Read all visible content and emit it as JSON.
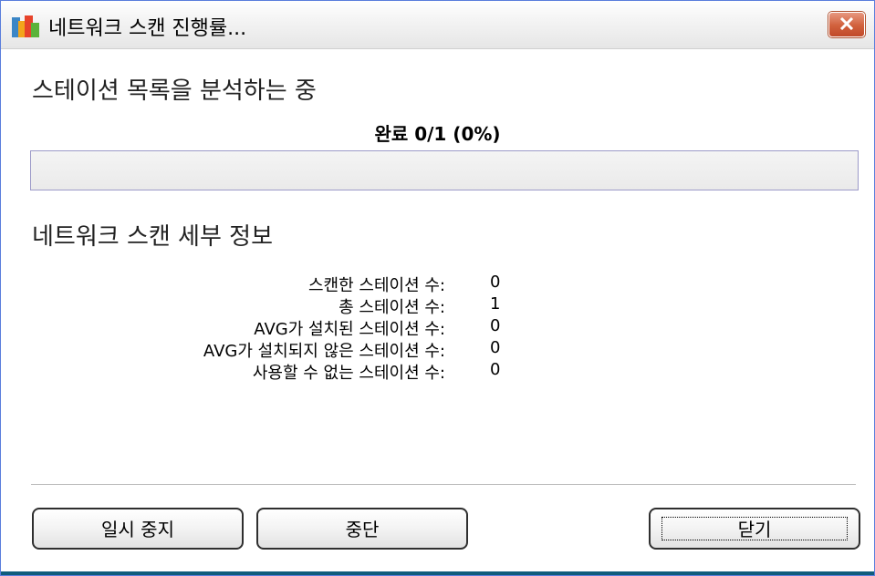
{
  "window": {
    "title": "네트워크 스캔 진행률..."
  },
  "status": {
    "heading": "스테이션 목록을 분석하는 중",
    "progress_label": "완료 0/1 (0%)",
    "progress_fraction": 0
  },
  "details": {
    "heading": "네트워크 스캔 세부 정보",
    "rows": [
      {
        "label": "스캔한 스테이션 수:",
        "value": "0"
      },
      {
        "label": "총 스테이션 수:",
        "value": "1"
      },
      {
        "label": "AVG가 설치된 스테이션 수:",
        "value": "0"
      },
      {
        "label": "AVG가 설치되지 않은 스테이션 수:",
        "value": "0"
      },
      {
        "label": "사용할 수 없는 스테이션 수:",
        "value": "0"
      }
    ]
  },
  "buttons": {
    "pause": "일시 중지",
    "stop": "중단",
    "close": "닫기"
  },
  "icons": {
    "app": "avg-logo-icon",
    "close": "close-icon"
  }
}
